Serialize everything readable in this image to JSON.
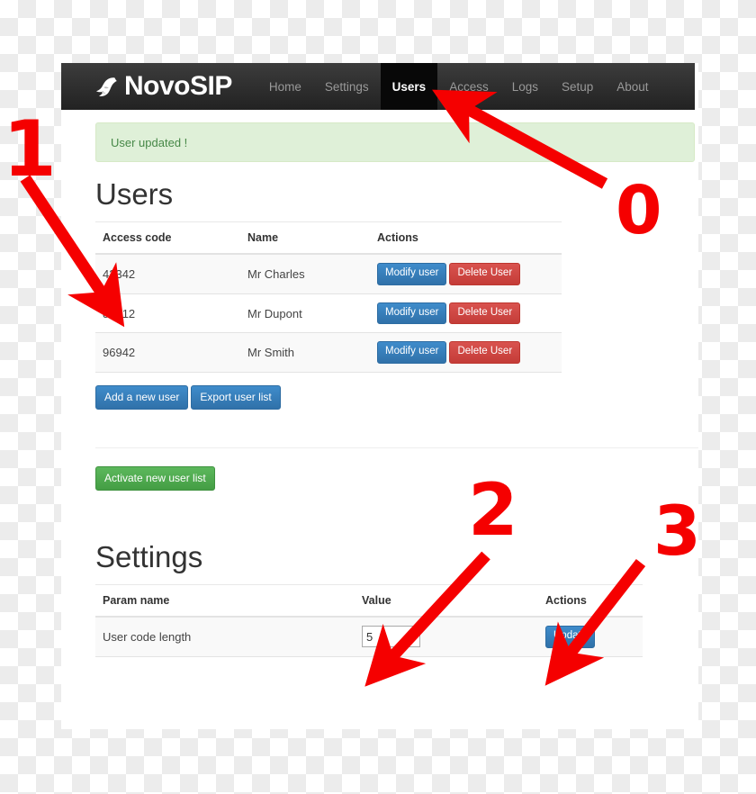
{
  "brand": {
    "name": "NovoSIP",
    "logo_icon": "bird-logo-icon"
  },
  "nav": {
    "items": [
      {
        "label": "Home",
        "active": false
      },
      {
        "label": "Settings",
        "active": false
      },
      {
        "label": "Users",
        "active": true
      },
      {
        "label": "Access",
        "active": false
      },
      {
        "label": "Logs",
        "active": false
      },
      {
        "label": "Setup",
        "active": false
      },
      {
        "label": "About",
        "active": false
      }
    ]
  },
  "alert": {
    "message": "User updated !",
    "type": "success",
    "background_color": "#dff0d8",
    "text_color": "#468847"
  },
  "users_section": {
    "title": "Users",
    "columns": [
      "Access code",
      "Name",
      "Actions"
    ],
    "rows": [
      {
        "access_code": "42342",
        "name": "Mr Charles",
        "modify_label": "Modify user",
        "delete_label": "Delete User"
      },
      {
        "access_code": "81212",
        "name": "Mr Dupont",
        "modify_label": "Modify user",
        "delete_label": "Delete User"
      },
      {
        "access_code": "96942",
        "name": "Mr Smith",
        "modify_label": "Modify user",
        "delete_label": "Delete User"
      }
    ],
    "add_user_label": "Add a new user",
    "export_label": "Export user list",
    "activate_label": "Activate new user list"
  },
  "settings_section": {
    "title": "Settings",
    "columns": [
      "Param name",
      "Value",
      "Actions"
    ],
    "rows": [
      {
        "param_name": "User code length",
        "value": "5",
        "action_label": "Update"
      }
    ]
  },
  "annotations": {
    "accent_color": "#f50000",
    "markers": [
      {
        "label": "0",
        "target": "nav-users-tab"
      },
      {
        "label": "1",
        "target": "first-user-access-code"
      },
      {
        "label": "2",
        "target": "settings-value-input"
      },
      {
        "label": "3",
        "target": "settings-update-button"
      }
    ]
  },
  "theme": {
    "navbar_background": "#222222",
    "primary_button": "#3071a9",
    "danger_button": "#c43c38",
    "success_button": "#449d44"
  }
}
